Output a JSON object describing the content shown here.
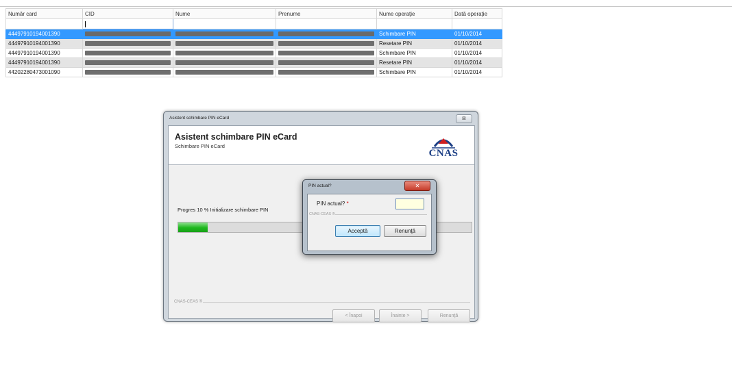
{
  "table": {
    "columns": [
      "Număr card",
      "CID",
      "Nume",
      "Prenume",
      "Nume operaţie",
      "Dată operaţie"
    ],
    "rows": [
      {
        "card": "44497910194001390",
        "operation": "Schimbare PIN",
        "date": "01/10/2014",
        "state": "selected"
      },
      {
        "card": "44497910194001390",
        "operation": "Resetare PIN",
        "date": "01/10/2014",
        "state": "alt"
      },
      {
        "card": "44497910194001390",
        "operation": "Schimbare PIN",
        "date": "01/10/2014",
        "state": "normal"
      },
      {
        "card": "44497910194001390",
        "operation": "Resetare PIN",
        "date": "01/10/2014",
        "state": "alt"
      },
      {
        "card": "44202280473001090",
        "operation": "Schimbare PIN",
        "date": "01/10/2014",
        "state": "normal"
      }
    ]
  },
  "wizard": {
    "window_title": "Asistent schimbare PIN eCard",
    "close_label": "⊠",
    "heading": "Asistent schimbare PIN eCard",
    "subheading": "Schimbare PIN eCard",
    "logo_text": "CNAS",
    "progress_label": "Progres 10 % Initializare schimbare PIN",
    "progress_percent": 10,
    "group_label": "CNAS-CEAS ®",
    "back_label": "< Înapoi",
    "next_label": "Înainte >",
    "cancel_label": "Renunţă"
  },
  "dialog": {
    "title": "PIN actual?",
    "close_label": "✕",
    "field_label": "PIN actual?",
    "required_marker": "*",
    "input_value": "",
    "group_label": "CNAS-CEAS ®",
    "accept_label": "Acceptă",
    "cancel_label": "Renunţă"
  }
}
